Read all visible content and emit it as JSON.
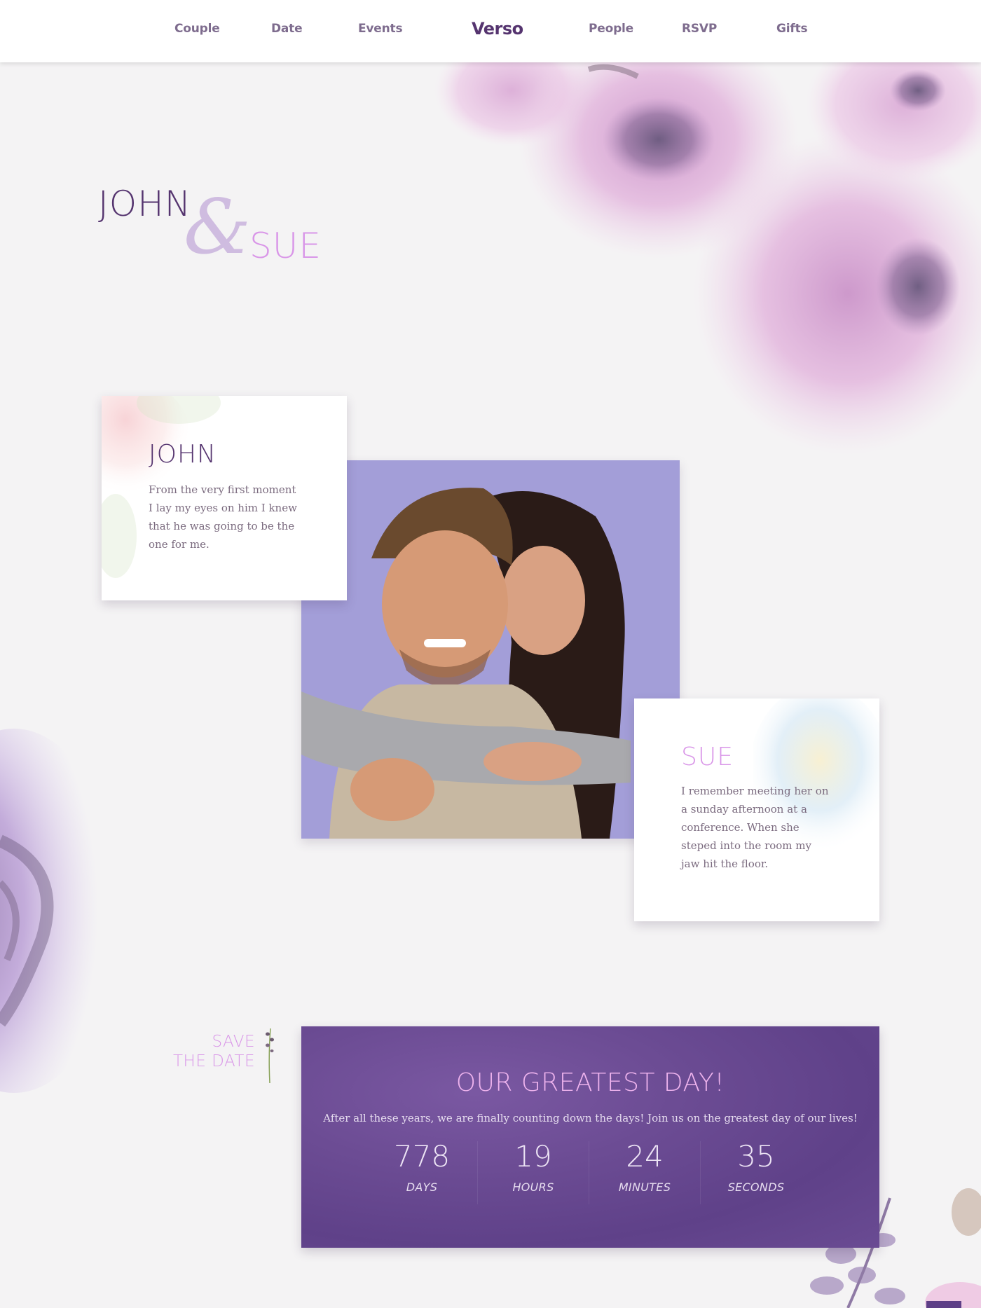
{
  "nav": {
    "items_left": [
      "Couple",
      "Date",
      "Events"
    ],
    "brand": "Verso",
    "items_right": [
      "People",
      "RSVP",
      "Gifts"
    ]
  },
  "hero": {
    "groom": "JOHN",
    "ampersand": "&",
    "bride": "SUE"
  },
  "couple": {
    "john": {
      "name": "JOHN",
      "text": "From the very first moment I lay my eyes on him I knew that he was going to be the one for me."
    },
    "sue": {
      "name": "SUE",
      "text": "I remember meeting her on a sunday afternoon at a conference. When she steped into the room my jaw hit the floor."
    },
    "photo_icon": "couple-photo"
  },
  "save_the_date": {
    "line1": "SAVE",
    "line2": "THE DATE"
  },
  "countdown": {
    "title": "OUR GREATEST DAY!",
    "lead": "After all these years, we are finally counting down the days! Join us on the greatest day of our lives!",
    "units": [
      {
        "value": "778",
        "label": "DAYS"
      },
      {
        "value": "19",
        "label": "HOURS"
      },
      {
        "value": "24",
        "label": "MINUTES"
      },
      {
        "value": "35",
        "label": "SECONDS"
      }
    ]
  },
  "colors": {
    "accent_dark": "#55346f",
    "accent_pink": "#d996e8",
    "countdown_bg": "#6a4b93",
    "photo_bg": "#a39ed8",
    "page_bg": "#f4f3f4"
  },
  "icons": [
    "flower-decoration-icon",
    "sprig-icon",
    "scroll-to-top-icon"
  ]
}
